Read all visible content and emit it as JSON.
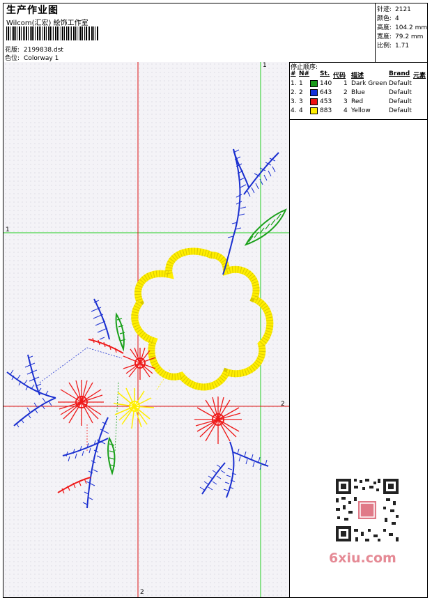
{
  "header": {
    "title": "生产作业图",
    "company": "Wilcom(汇宏) 絵饰工作室",
    "design_label": "花版:",
    "design_value": "2199838.dst",
    "colorway_label": "色位:",
    "colorway_value": "Colorway 1"
  },
  "stats": [
    {
      "label": "针迹:",
      "value": "2121"
    },
    {
      "label": "颜色:",
      "value": "4"
    },
    {
      "label": "高度:",
      "value": "104.2 mm"
    },
    {
      "label": "宽度:",
      "value": "79.2 mm"
    },
    {
      "label": "比例:",
      "value": "1.71"
    }
  ],
  "stops": {
    "title": "停止顺序:",
    "headers": {
      "hash": "#",
      "no": "N#",
      "st": "St.",
      "code": "代码",
      "desc": "描述",
      "brand": "Brand",
      "element": "元素"
    },
    "rows": [
      {
        "idx": "1.",
        "no": "1",
        "color": "#1a9a1a",
        "st": "140",
        "code": "1",
        "desc": "Dark Green",
        "brand": "Default"
      },
      {
        "idx": "2.",
        "no": "2",
        "color": "#1530d8",
        "st": "643",
        "code": "2",
        "desc": "Blue",
        "brand": "Default"
      },
      {
        "idx": "3.",
        "no": "3",
        "color": "#ee1111",
        "st": "453",
        "code": "3",
        "desc": "Red",
        "brand": "Default"
      },
      {
        "idx": "4.",
        "no": "4",
        "color": "#ffee00",
        "st": "883",
        "code": "4",
        "desc": "Yellow",
        "brand": "Default"
      }
    ]
  },
  "guides": {
    "green_label": "1",
    "red_label": "2"
  },
  "watermark": {
    "text": "6xiu.com"
  },
  "colors": {
    "green_guide": "#22cc22",
    "red_guide": "#dd1111",
    "blue_thread": "#1a2fd0",
    "red_thread": "#ee1a1a",
    "yellow_thread": "#ffee00",
    "green_thread": "#1aa01a"
  }
}
